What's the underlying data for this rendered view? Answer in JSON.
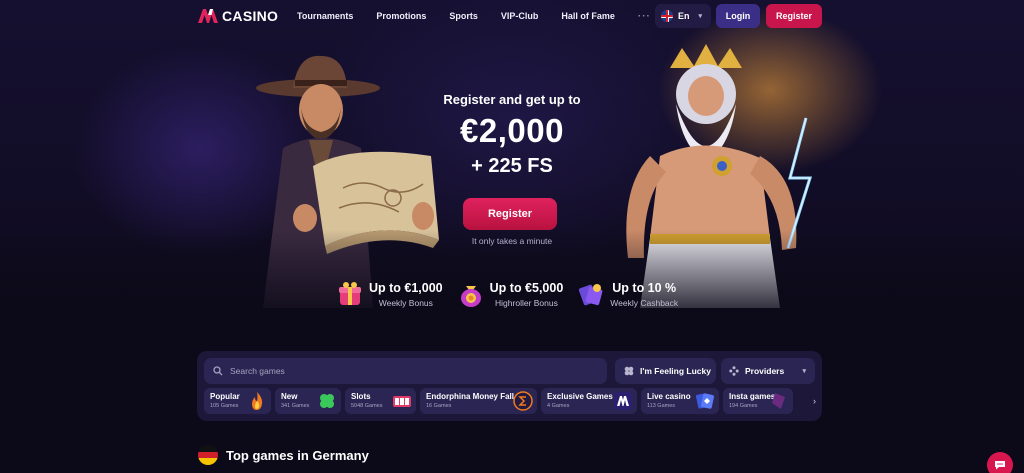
{
  "header": {
    "logo_text": "CASINO",
    "nav": [
      "Tournaments",
      "Promotions",
      "Sports",
      "VIP-Club",
      "Hall of Fame"
    ],
    "nav_more": "···",
    "language": "En",
    "login_label": "Login",
    "register_label": "Register"
  },
  "hero": {
    "subtitle": "Register and get up to",
    "amount": "€2,000",
    "free_spins": "+ 225 FS",
    "cta_label": "Register",
    "note": "It only takes a minute"
  },
  "bonuses": [
    {
      "title": "Up to €1,000",
      "subtitle": "Weekly Bonus",
      "icon": "gift-box-icon"
    },
    {
      "title": "Up to €5,000",
      "subtitle": "Highroller Bonus",
      "icon": "money-bag-icon"
    },
    {
      "title": "Up to 10 %",
      "subtitle": "Weekly Cashback",
      "icon": "cashback-icon"
    }
  ],
  "search": {
    "placeholder": "Search games",
    "lucky_label": "I'm Feeling Lucky",
    "providers_label": "Providers"
  },
  "categories": [
    {
      "name": "Popular",
      "count": "105 Games",
      "icon": "flame-icon"
    },
    {
      "name": "New",
      "count": "341 Games",
      "icon": "clover-icon"
    },
    {
      "name": "Slots",
      "count": "5048 Games",
      "icon": "slot-machine-icon"
    },
    {
      "name": "Endorphina Money Fall",
      "count": "16 Games",
      "icon": "endorphina-icon"
    },
    {
      "name": "Exclusive Games",
      "count": "4 Games",
      "icon": "exclusive-icon"
    },
    {
      "name": "Live casino",
      "count": "113 Games",
      "icon": "cards-icon"
    },
    {
      "name": "Insta games",
      "count": "194 Games",
      "icon": "insta-icon"
    }
  ],
  "top_games": {
    "title": "Top games in Germany"
  },
  "colors": {
    "accent": "#c8154c",
    "login": "#3a2e86",
    "panel": "#1d183a",
    "background": "#0c0a18"
  }
}
